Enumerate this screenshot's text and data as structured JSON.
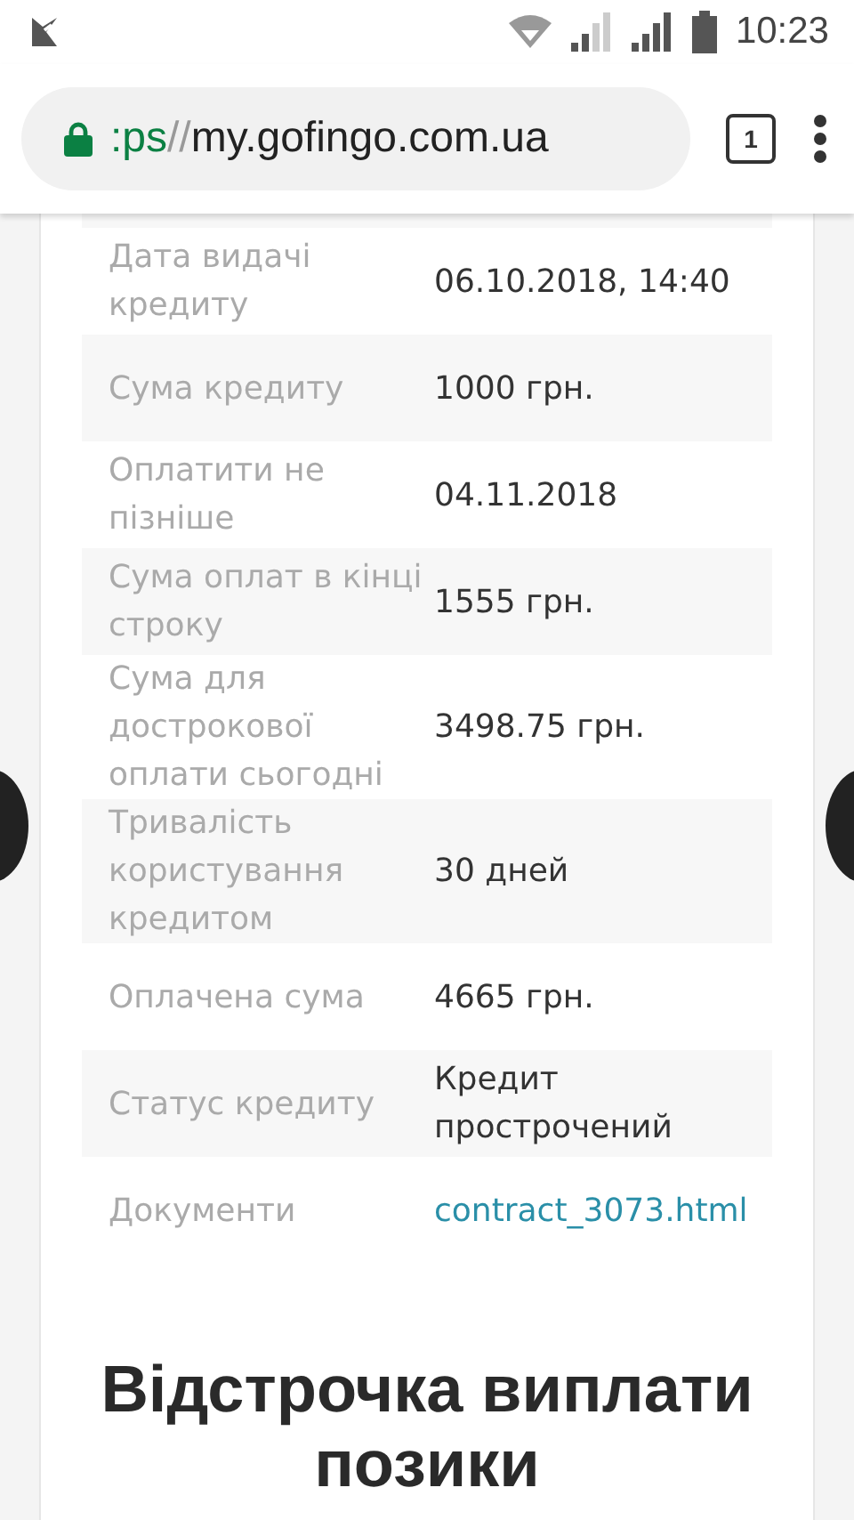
{
  "status_bar": {
    "time": "10:23"
  },
  "address_bar": {
    "url_scheme": ":ps",
    "url_separator": "//",
    "url_host": "my.gofingo.com.ua",
    "tab_count": "1"
  },
  "details": [
    {
      "label": "Дата видачі кредиту",
      "value": "06.10.2018, 14:40",
      "kind": "text"
    },
    {
      "label": "Сума кредиту",
      "value": "1000 грн.",
      "kind": "text"
    },
    {
      "label": "Оплатити не пізніше",
      "value": "04.11.2018",
      "kind": "text"
    },
    {
      "label": "Сума оплат в кінці строку",
      "value": "1555 грн.",
      "kind": "text"
    },
    {
      "label": "Сума для дострокової оплати сьогодні",
      "value": "3498.75 грн.",
      "kind": "text"
    },
    {
      "label": "Тривалість користування кредитом",
      "value": "30 дней",
      "kind": "text"
    },
    {
      "label": "Оплачена сума",
      "value": "4665 грн.",
      "kind": "text"
    },
    {
      "label": "Статус кредиту",
      "value": "Кредит прострочений",
      "kind": "text"
    },
    {
      "label": "Документи",
      "value": "contract_3073.html",
      "kind": "link"
    }
  ],
  "section_title": "Відстрочка виплати позики"
}
